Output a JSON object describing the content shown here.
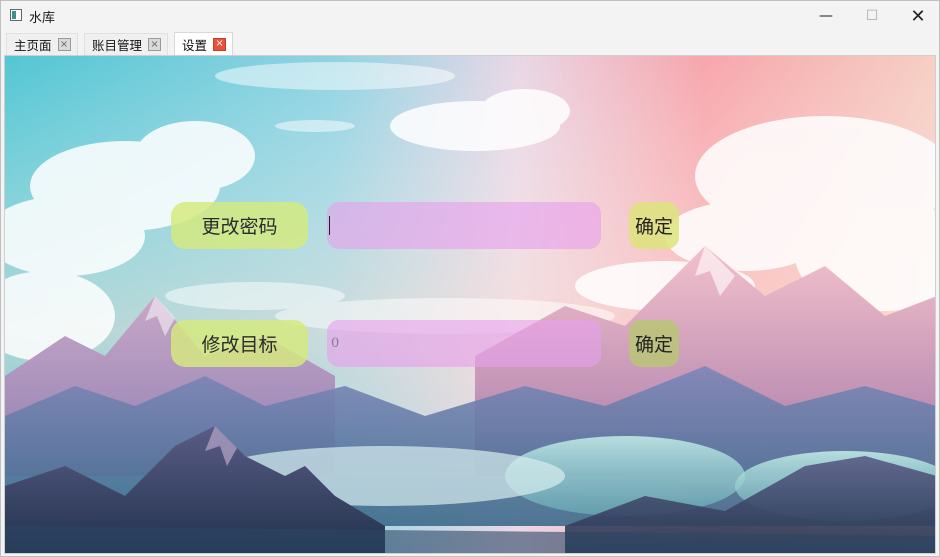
{
  "window": {
    "title": "水库",
    "controls": {
      "minimize": "—",
      "maximize": "☐",
      "close": "✕"
    }
  },
  "tabs": [
    {
      "label": "主页面",
      "close": "×",
      "active": false
    },
    {
      "label": "账目管理",
      "close": "×",
      "active": false
    },
    {
      "label": "设置",
      "close": "×",
      "active": true
    }
  ],
  "settings": {
    "password": {
      "label": "更改密码",
      "value": "",
      "confirm": "确定"
    },
    "target": {
      "label": "修改目标",
      "value": "0",
      "confirm": "确定"
    }
  },
  "colors": {
    "label_button": "#d6ea7d",
    "field": "#e6a0eb",
    "confirm_button": "#dde47d",
    "close_active": "#e8523b"
  }
}
